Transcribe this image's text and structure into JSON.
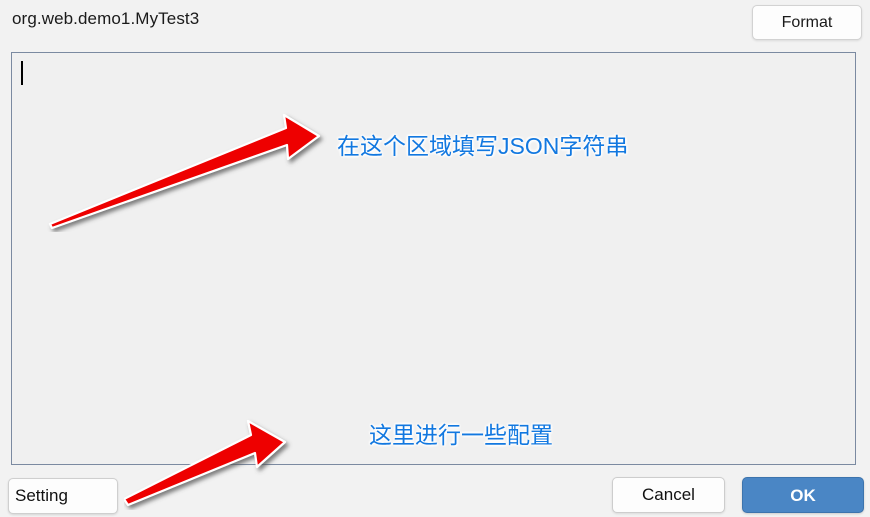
{
  "dialog": {
    "title": "org.web.demo1.MyTest3",
    "background_color": "#f2f2f2"
  },
  "header": {
    "format_label": "Format"
  },
  "editor": {
    "value": "",
    "placeholder": "",
    "background_color": "#f0f0f0",
    "border_color": "#7b8aa1"
  },
  "annotations": {
    "arrow_color": "#ee0000",
    "text_color": "#1278e0",
    "json_label": "在这个区域填写JSON字符串",
    "config_label": "这里进行一些配置"
  },
  "footer": {
    "setting_label": "Setting",
    "cancel_label": "Cancel",
    "ok_label": "OK",
    "ok_color": "#4a86c5"
  }
}
